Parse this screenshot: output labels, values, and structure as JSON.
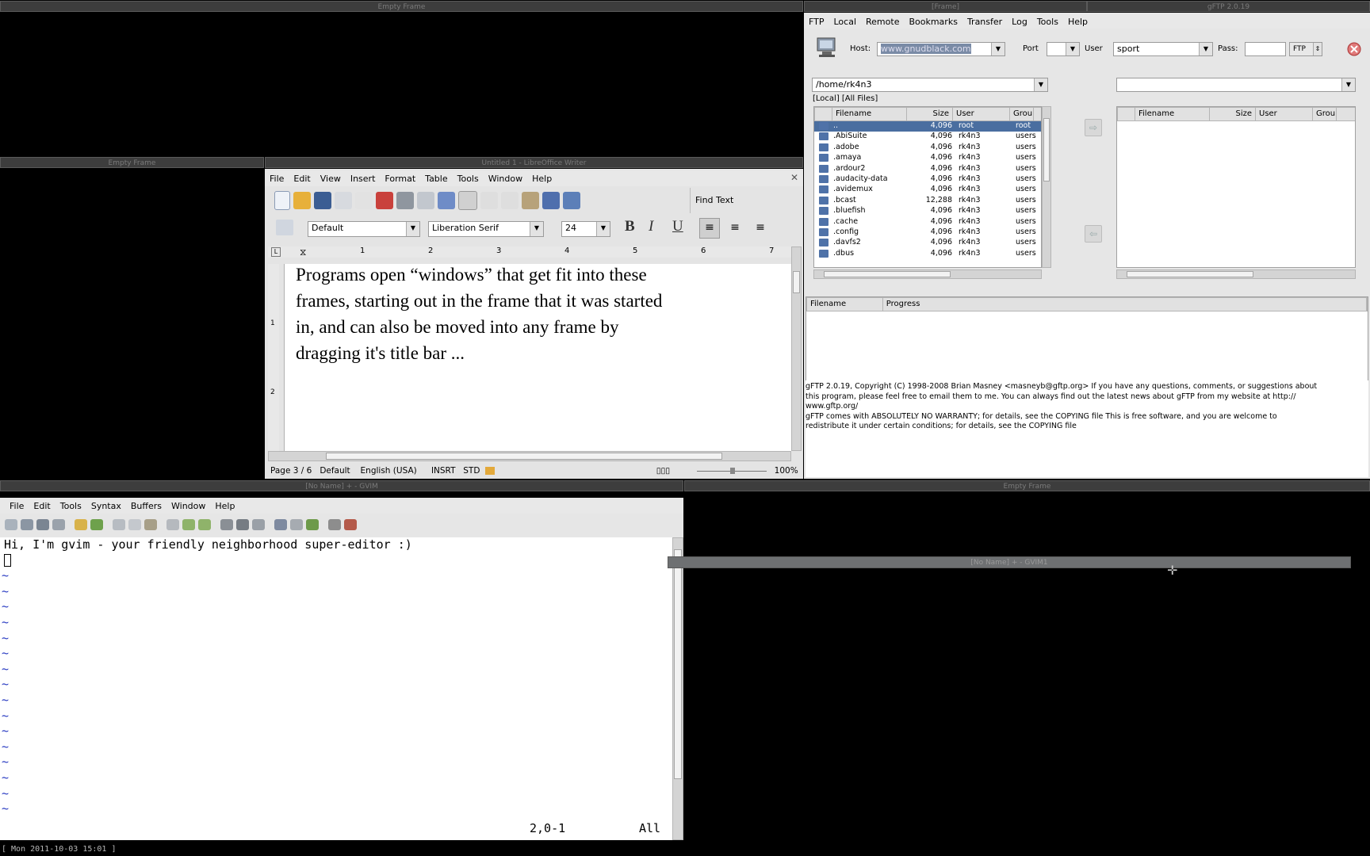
{
  "frames": {
    "top_left_title": "Empty Frame",
    "top_right_title": "[Frame]",
    "gftp_title": "gFTP 2.0.19",
    "mid_left_title": "Empty Frame",
    "writer_title": "Untitled 1 - LibreOffice Writer",
    "gvim_title": "[No Name] + - GVIM",
    "bottom_right_title": "Empty Frame",
    "dragging_title": "[No Name] + - GVIM1"
  },
  "gftp": {
    "menu": [
      "FTP",
      "Local",
      "Remote",
      "Bookmarks",
      "Transfer",
      "Log",
      "Tools",
      "Help"
    ],
    "host_label": "Host:",
    "host_value": "www.gnudblack.com",
    "port_label": "Port",
    "port_value": "",
    "user_label": "User",
    "user_value": "sport",
    "pass_label": "Pass:",
    "pass_value": "",
    "protocol": "FTP",
    "local_path": "/home/rk4n3",
    "local_filter": "[Local] [All Files]",
    "remote_path": "",
    "columns": [
      "Filename",
      "Size",
      "User",
      "Grou"
    ],
    "local_files": [
      {
        "name": "..",
        "size": "4,096",
        "user": "root",
        "group": "root"
      },
      {
        "name": ".AbiSuite",
        "size": "4,096",
        "user": "rk4n3",
        "group": "users"
      },
      {
        "name": ".adobe",
        "size": "4,096",
        "user": "rk4n3",
        "group": "users"
      },
      {
        "name": ".amaya",
        "size": "4,096",
        "user": "rk4n3",
        "group": "users"
      },
      {
        "name": ".ardour2",
        "size": "4,096",
        "user": "rk4n3",
        "group": "users"
      },
      {
        "name": ".audacity-data",
        "size": "4,096",
        "user": "rk4n3",
        "group": "users"
      },
      {
        "name": ".avidemux",
        "size": "4,096",
        "user": "rk4n3",
        "group": "users"
      },
      {
        "name": ".bcast",
        "size": "12,288",
        "user": "rk4n3",
        "group": "users"
      },
      {
        "name": ".bluefish",
        "size": "4,096",
        "user": "rk4n3",
        "group": "users"
      },
      {
        "name": ".cache",
        "size": "4,096",
        "user": "rk4n3",
        "group": "users"
      },
      {
        "name": ".config",
        "size": "4,096",
        "user": "rk4n3",
        "group": "users"
      },
      {
        "name": ".davfs2",
        "size": "4,096",
        "user": "rk4n3",
        "group": "users"
      },
      {
        "name": ".dbus",
        "size": "4,096",
        "user": "rk4n3",
        "group": "users"
      }
    ],
    "transfer_columns": [
      "Filename",
      "Progress"
    ],
    "log_lines": [
      "gFTP 2.0.19, Copyright (C) 1998-2008 Brian Masney <masneyb@gftp.org>  If you have any questions, comments, or suggestions about",
      "this program, please feel free to email them to me. You can always find out the latest news about gFTP from my website at http://",
      "www.gftp.org/",
      "gFTP comes with ABSOLUTELY NO WARRANTY; for details, see the COPYING file  This is free software, and you are welcome to",
      "redistribute it under certain conditions; for details, see the COPYING file"
    ]
  },
  "writer": {
    "menu": [
      "File",
      "Edit",
      "View",
      "Insert",
      "Format",
      "Table",
      "Tools",
      "Window",
      "Help"
    ],
    "find_text": "Find Text",
    "style": "Default",
    "font": "Liberation Serif",
    "size": "24",
    "bold": "B",
    "italic": "I",
    "underline": "U",
    "ruler_numbers": [
      "1",
      "2",
      "3",
      "4",
      "5",
      "6",
      "7"
    ],
    "vruler_numbers": [
      "1",
      "2"
    ],
    "body_lines": [
      "Programs open “windows” that get fit into these",
      "frames, starting out in the frame that it was started",
      "in, and can also be moved into any frame by",
      "dragging it's title bar ..."
    ],
    "status": {
      "page": "Page 3 / 6",
      "style": "Default",
      "language": "English (USA)",
      "insert": "INSRT",
      "selection": "STD",
      "zoom": "100%"
    }
  },
  "gvim": {
    "menu": [
      "File",
      "Edit",
      "Tools",
      "Syntax",
      "Buffers",
      "Window",
      "Help"
    ],
    "first_line": "Hi, I'm gvim - your friendly neighborhood super-editor :)",
    "tilde": "~",
    "position": "2,0-1",
    "scroll": "All"
  },
  "statusbar": {
    "clock": "[ Mon 2011-10-03 15:01 ]"
  }
}
